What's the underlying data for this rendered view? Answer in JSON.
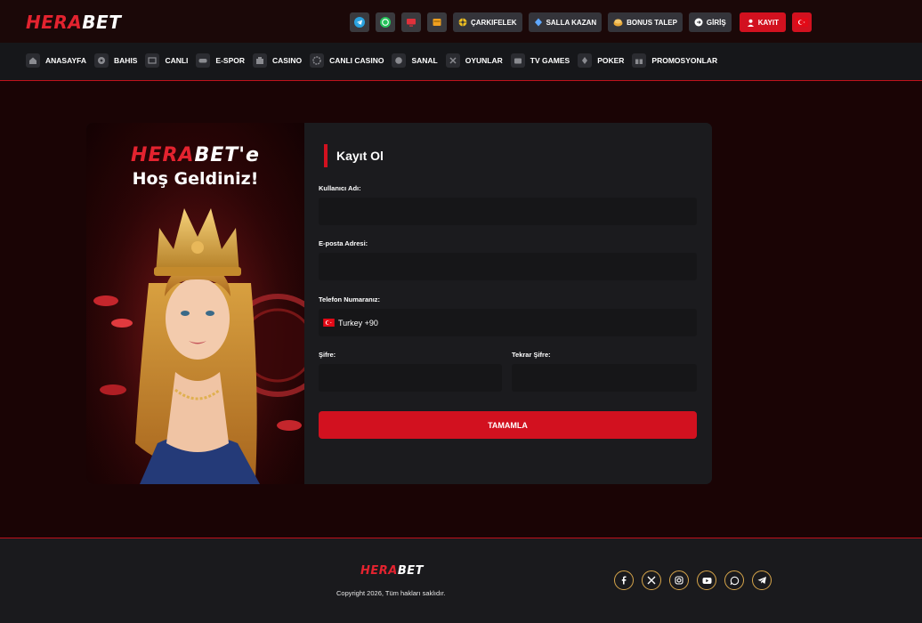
{
  "brand": {
    "part1": "HERA",
    "part2": "BET"
  },
  "header": {
    "icon_buttons": [
      {
        "icon": "telegram-icon",
        "color": "#2aa3e0"
      },
      {
        "icon": "whatsapp-icon",
        "color": "#25c35a"
      },
      {
        "icon": "monitor-icon",
        "color": "#e0313b"
      },
      {
        "icon": "calendar-icon",
        "color": "#f0a020"
      }
    ],
    "carkifelek": "ÇARKIFELEK",
    "salla_kazan": "SALLA KAZAN",
    "bonus_talep": "BONUS TALEP",
    "giris": "GİRİŞ",
    "kayit": "KAYIT",
    "language_flag": "turkey-flag-icon"
  },
  "nav": {
    "items": [
      {
        "label": "ANASAYFA",
        "icon": "home-icon"
      },
      {
        "label": "BAHIS",
        "icon": "soccer-ball-icon"
      },
      {
        "label": "CANLI",
        "icon": "live-screen-icon"
      },
      {
        "label": "E-SPOR",
        "icon": "gamepad-icon"
      },
      {
        "label": "CASINO",
        "icon": "slot-icon"
      },
      {
        "label": "CANLI CASINO",
        "icon": "chip-icon"
      },
      {
        "label": "SANAL",
        "icon": "virtual-icon"
      },
      {
        "label": "OYUNLAR",
        "icon": "games-icon"
      },
      {
        "label": "TV GAMES",
        "icon": "tv-icon"
      },
      {
        "label": "POKER",
        "icon": "cards-icon"
      },
      {
        "label": "PROMOSYONLAR",
        "icon": "gift-icon"
      }
    ]
  },
  "promo": {
    "brand1": "HERA",
    "brand2": "BET'e",
    "welcome": "Hoş Geldiniz!"
  },
  "form": {
    "title": "Kayıt Ol",
    "username_label": "Kullanıcı Adı:",
    "username_value": "",
    "email_label": "E-posta Adresi:",
    "email_value": "",
    "phone_label": "Telefon Numaranız:",
    "phone_country": "Turkey +90",
    "password_label": "Şifre:",
    "password_value": "",
    "password_repeat_label": "Tekrar Şifre:",
    "password_repeat_value": "",
    "submit": "TAMAMLA"
  },
  "footer": {
    "copyright": "Copyright 2026, Tüm hakları saklıdır.",
    "socials": [
      "facebook-icon",
      "x-icon",
      "instagram-icon",
      "youtube-icon",
      "whatsapp-icon",
      "telegram-icon"
    ]
  },
  "colors": {
    "accent": "#d2111f",
    "brand_red": "#e3232f",
    "social_border": "#d8a64a"
  }
}
